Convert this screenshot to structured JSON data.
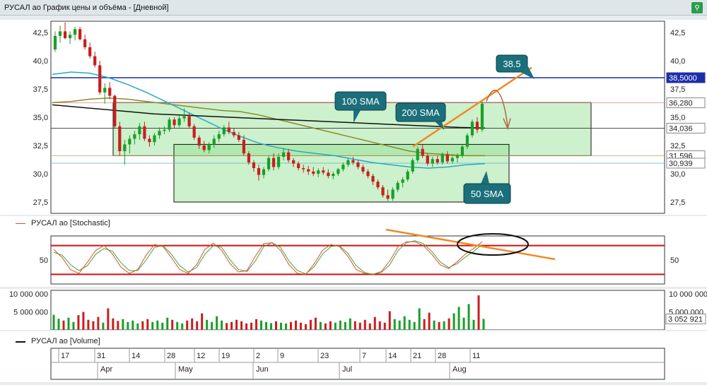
{
  "window": {
    "title": "РУСАЛ ао График цены и объёма - [Дневной]",
    "pin_icon": "pin-icon"
  },
  "colors": {
    "up": "#1a9e2a",
    "down": "#c81e1e",
    "sma50": "#2aa7c9",
    "sma100": "#8b8a2a",
    "sma200": "#111111",
    "hline": "#1c2fa8",
    "box_fill": "#8ee08e",
    "trend": "#f08a24",
    "stoch_k": "#e05030",
    "stoch_d": "#3aa83a",
    "stoch_band": "#d01010"
  },
  "price_pane": {
    "price_ticks_left": [
      "42,5",
      "40,0",
      "37,5",
      "35,0",
      "32,5",
      "30,0",
      "27,5"
    ],
    "price_ticks_right": [
      "42,5",
      "40,0",
      "37,5",
      "35,0",
      "32,5",
      "30,0",
      "27,5"
    ],
    "badges": [
      {
        "text": "38,5000",
        "color": "#1c2fa8"
      },
      {
        "text": "36,280",
        "color": "#ffffff"
      },
      {
        "text": "34,036",
        "color": "#ffffff"
      },
      {
        "text": "31,596",
        "color": "#ffffff"
      },
      {
        "text": "30,939",
        "color": "#ffffff"
      }
    ],
    "annotations": [
      "100 SMA",
      "200 SMA",
      "50 SMA",
      "38.5"
    ]
  },
  "stoch_pane": {
    "label": "РУСАЛ ао [Stochastic]",
    "ticks_left": [
      "50"
    ],
    "ticks_right": [
      "50"
    ]
  },
  "volume_pane": {
    "label": "РУСАЛ ао [Volume]",
    "ticks_left": [
      "10 000 000",
      "5 000 000"
    ],
    "ticks_right": [
      "10 000 000",
      "5 000 000",
      "3 052 921"
    ]
  },
  "time_axis": {
    "days": [
      "17",
      "31",
      "14",
      "28",
      "12",
      "19",
      "2",
      "9",
      "23",
      "7",
      "14",
      "21",
      "28",
      "11"
    ],
    "months": [
      "Apr",
      "May",
      "Jun",
      "Jul",
      "Aug"
    ]
  },
  "chart_data": {
    "type": "candlestick",
    "title": "РУСАЛ ао График цены и объёма - [Дневной]",
    "price_range": [
      26.5,
      43.5
    ],
    "horizontal_levels": [
      38.5,
      34.036,
      31.596,
      30.939,
      36.28
    ],
    "candles": [
      [
        41.0,
        42.6,
        40.8,
        42.2
      ],
      [
        42.2,
        43.1,
        41.6,
        42.6
      ],
      [
        42.6,
        43.4,
        41.9,
        42.0
      ],
      [
        42.0,
        42.6,
        41.5,
        42.3
      ],
      [
        42.3,
        43.0,
        41.8,
        42.8
      ],
      [
        42.8,
        43.0,
        41.8,
        41.9
      ],
      [
        41.9,
        42.3,
        41.0,
        41.2
      ],
      [
        41.2,
        41.6,
        40.2,
        40.4
      ],
      [
        40.4,
        40.8,
        39.4,
        39.6
      ],
      [
        39.6,
        40.0,
        37.0,
        37.2
      ],
      [
        37.2,
        38.0,
        36.2,
        37.6
      ],
      [
        37.6,
        38.1,
        36.6,
        36.9
      ],
      [
        36.9,
        37.0,
        34.0,
        34.2
      ],
      [
        34.2,
        34.6,
        31.6,
        32.0
      ],
      [
        32.0,
        33.0,
        30.8,
        32.6
      ],
      [
        32.6,
        33.4,
        31.8,
        33.1
      ],
      [
        33.1,
        33.8,
        32.6,
        33.5
      ],
      [
        33.5,
        34.5,
        33.0,
        34.2
      ],
      [
        34.2,
        34.6,
        32.9,
        33.1
      ],
      [
        33.1,
        33.4,
        32.4,
        32.8
      ],
      [
        32.8,
        33.6,
        32.5,
        33.4
      ],
      [
        33.4,
        34.1,
        33.1,
        33.8
      ],
      [
        33.8,
        34.2,
        33.5,
        33.9
      ],
      [
        33.9,
        35.0,
        33.7,
        34.8
      ],
      [
        34.8,
        35.0,
        34.0,
        34.3
      ],
      [
        34.3,
        35.2,
        34.1,
        34.9
      ],
      [
        34.9,
        35.8,
        34.6,
        35.1
      ],
      [
        35.1,
        35.4,
        34.0,
        34.2
      ],
      [
        34.2,
        34.4,
        33.0,
        33.2
      ],
      [
        33.2,
        33.4,
        32.2,
        32.5
      ],
      [
        32.5,
        32.9,
        31.9,
        32.1
      ],
      [
        32.1,
        32.8,
        31.8,
        32.6
      ],
      [
        32.6,
        33.4,
        32.3,
        33.1
      ],
      [
        33.1,
        33.8,
        32.8,
        33.5
      ],
      [
        33.5,
        34.3,
        33.3,
        34.1
      ],
      [
        34.1,
        34.6,
        33.5,
        33.7
      ],
      [
        33.7,
        34.0,
        33.2,
        33.4
      ],
      [
        33.4,
        33.7,
        32.8,
        33.0
      ],
      [
        33.0,
        33.4,
        31.6,
        31.8
      ],
      [
        31.8,
        32.0,
        30.8,
        31.0
      ],
      [
        31.0,
        31.2,
        30.2,
        30.5
      ],
      [
        30.5,
        30.8,
        29.4,
        29.9
      ],
      [
        29.9,
        30.6,
        29.6,
        30.4
      ],
      [
        30.4,
        31.6,
        30.2,
        31.4
      ],
      [
        31.4,
        31.8,
        30.3,
        30.6
      ],
      [
        30.6,
        31.8,
        30.4,
        31.5
      ],
      [
        31.5,
        32.3,
        31.2,
        31.9
      ],
      [
        31.9,
        32.2,
        31.0,
        31.2
      ],
      [
        31.2,
        31.4,
        30.6,
        30.9
      ],
      [
        30.9,
        31.1,
        30.3,
        30.5
      ],
      [
        30.5,
        30.8,
        30.1,
        30.4
      ],
      [
        30.4,
        30.7,
        29.9,
        30.2
      ],
      [
        30.2,
        30.6,
        29.8,
        30.0
      ],
      [
        30.0,
        30.5,
        29.7,
        30.3
      ],
      [
        30.3,
        30.6,
        29.9,
        30.1
      ],
      [
        30.1,
        30.4,
        29.6,
        29.8
      ],
      [
        29.8,
        30.2,
        29.5,
        30.0
      ],
      [
        30.0,
        30.5,
        29.8,
        30.4
      ],
      [
        30.4,
        31.0,
        30.2,
        30.8
      ],
      [
        30.8,
        31.4,
        30.6,
        31.2
      ],
      [
        31.2,
        31.5,
        30.8,
        31.0
      ],
      [
        31.0,
        31.2,
        30.4,
        30.6
      ],
      [
        30.6,
        30.8,
        30.0,
        30.2
      ],
      [
        30.2,
        30.4,
        29.6,
        29.8
      ],
      [
        29.8,
        30.0,
        29.0,
        29.3
      ],
      [
        29.3,
        29.5,
        28.6,
        28.8
      ],
      [
        28.8,
        29.0,
        27.9,
        28.1
      ],
      [
        28.1,
        28.6,
        27.6,
        27.8
      ],
      [
        27.8,
        28.8,
        27.6,
        28.6
      ],
      [
        28.6,
        29.4,
        28.4,
        29.2
      ],
      [
        29.2,
        29.7,
        28.8,
        29.5
      ],
      [
        29.5,
        30.4,
        29.3,
        30.2
      ],
      [
        30.2,
        31.4,
        30.0,
        31.2
      ],
      [
        31.2,
        32.4,
        31.0,
        32.2
      ],
      [
        32.2,
        32.6,
        31.4,
        31.6
      ],
      [
        31.6,
        31.8,
        30.7,
        30.9
      ],
      [
        30.9,
        31.5,
        30.6,
        31.3
      ],
      [
        31.3,
        31.6,
        30.8,
        31.0
      ],
      [
        31.0,
        31.9,
        30.8,
        31.7
      ],
      [
        31.7,
        32.0,
        30.9,
        31.1
      ],
      [
        31.1,
        31.6,
        30.9,
        31.4
      ],
      [
        31.4,
        31.8,
        31.0,
        31.6
      ],
      [
        31.6,
        32.6,
        31.4,
        32.4
      ],
      [
        32.4,
        33.6,
        32.2,
        33.4
      ],
      [
        33.4,
        34.8,
        33.2,
        34.6
      ],
      [
        34.6,
        35.0,
        33.6,
        33.9
      ],
      [
        33.9,
        36.4,
        33.7,
        36.2
      ]
    ],
    "sma50": [
      38.8,
      39.0,
      38.9,
      38.5,
      37.9,
      37.2,
      36.4,
      35.6,
      34.8,
      34.0,
      33.3,
      32.7,
      32.3,
      32.0,
      31.8,
      31.6,
      31.3,
      31.0,
      30.8,
      30.6,
      30.5,
      30.6,
      30.8,
      30.9
    ],
    "sma100": [
      36.3,
      36.4,
      36.6,
      36.7,
      36.6,
      36.4,
      36.2,
      36.0,
      35.8,
      35.6,
      35.5,
      35.2,
      34.8,
      34.4,
      34.0,
      33.6,
      33.2,
      32.8,
      32.4,
      32.0,
      31.8,
      31.7,
      31.6,
      31.6
    ],
    "sma200": [
      36.1,
      35.9,
      35.7,
      35.5,
      35.3,
      35.2,
      35.1,
      35.0,
      34.9,
      34.8,
      34.7,
      34.6,
      34.5,
      34.4,
      34.3,
      34.2,
      34.1,
      34.05
    ],
    "stochastic_k": [
      72,
      55,
      30,
      22,
      45,
      70,
      80,
      62,
      35,
      22,
      30,
      60,
      82,
      78,
      55,
      30,
      22,
      40,
      72,
      85,
      70,
      42,
      25,
      28,
      58,
      84,
      86,
      70,
      40,
      22,
      20,
      42,
      70,
      82,
      78,
      58,
      30,
      22,
      20,
      26,
      48,
      78,
      88,
      88,
      80,
      62,
      40,
      32,
      46,
      62,
      74,
      88
    ],
    "stochastic_d": [
      66,
      60,
      40,
      28,
      38,
      62,
      74,
      68,
      44,
      28,
      28,
      50,
      76,
      80,
      62,
      38,
      25,
      34,
      62,
      80,
      76,
      50,
      30,
      26,
      48,
      78,
      86,
      76,
      48,
      28,
      21,
      36,
      62,
      78,
      80,
      64,
      38,
      24,
      20,
      24,
      40,
      70,
      86,
      90,
      84,
      68,
      46,
      34,
      42,
      56,
      68,
      82
    ],
    "stochastic_levels": [
      80,
      20
    ],
    "volume": [
      4.2,
      3.1,
      2.6,
      3.4,
      2.2,
      4.1,
      5.0,
      2.8,
      2.4,
      3.6,
      2.0,
      6.0,
      3.2,
      2.5,
      3.0,
      2.2,
      2.6,
      1.8,
      2.4,
      3.0,
      2.2,
      2.6,
      2.0,
      3.4,
      2.8,
      2.2,
      1.8,
      2.6,
      3.2,
      2.4,
      4.6,
      2.8,
      2.2,
      3.8,
      2.6,
      1.9,
      2.2,
      2.8,
      2.4,
      1.8,
      2.0,
      3.0,
      2.6,
      2.2,
      1.9,
      2.4,
      2.0,
      1.8,
      2.2,
      2.6,
      2.0,
      1.6,
      2.8,
      3.4,
      2.2,
      1.8,
      2.4,
      2.0,
      2.6,
      2.2,
      3.2,
      2.4,
      2.0,
      2.8,
      1.8,
      3.6,
      2.4,
      2.0,
      5.2,
      3.0,
      2.6,
      3.8,
      2.8,
      2.2,
      6.0,
      3.0,
      4.8,
      2.6,
      2.2,
      2.4,
      3.2,
      4.6,
      6.4,
      3.4,
      7.2,
      2.8,
      9.6,
      3.05
    ],
    "volume_unit": "millions"
  }
}
